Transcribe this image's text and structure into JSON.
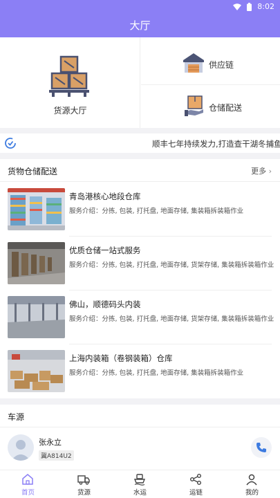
{
  "status_bar": {
    "time": "8:02"
  },
  "app_bar": {
    "title": "大厅"
  },
  "hero": {
    "main_label": "货源大厅",
    "supply_chain_label": "供应链",
    "warehouse_label": "仓储配送"
  },
  "ticker": {
    "text": "顺丰七年持续发力,打造查干湖冬捕鱼\""
  },
  "warehouse_section": {
    "title": "货物仓储配送",
    "more_label": "更多",
    "items": [
      {
        "name": "青岛港核心地段仓库",
        "desc": "服务介绍：分拣, 包装, 打托盘, 地面存储, 集装箱拆装箱作业"
      },
      {
        "name": "优质仓储一站式服务",
        "desc": "服务介绍：分拣, 包装, 打托盘, 地面存储, 货架存储, 集装箱拆装箱作业"
      },
      {
        "name": "佛山，顺德码头内装",
        "desc": "服务介绍：分拣, 包装, 打托盘, 地面存储, 货架存储, 集装箱拆装箱作业"
      },
      {
        "name": "上海内装箱（卷钢装箱）仓库",
        "desc": "服务介绍：分拣, 包装, 打托盘, 地面存储, 集装箱拆装箱作业"
      }
    ]
  },
  "cars_section": {
    "title": "车源",
    "driver_name": "张永立",
    "plate": "冀A814U2"
  },
  "tabbar": {
    "tabs": [
      {
        "label": "首页",
        "icon": "home-icon",
        "active": true
      },
      {
        "label": "货源",
        "icon": "truck-icon"
      },
      {
        "label": "水运",
        "icon": "ship-icon"
      },
      {
        "label": "运链",
        "icon": "share-icon"
      },
      {
        "label": "我的",
        "icon": "user-icon"
      }
    ]
  },
  "colors": {
    "primary": "#8b7ff5",
    "phone": "#3d7be0"
  }
}
